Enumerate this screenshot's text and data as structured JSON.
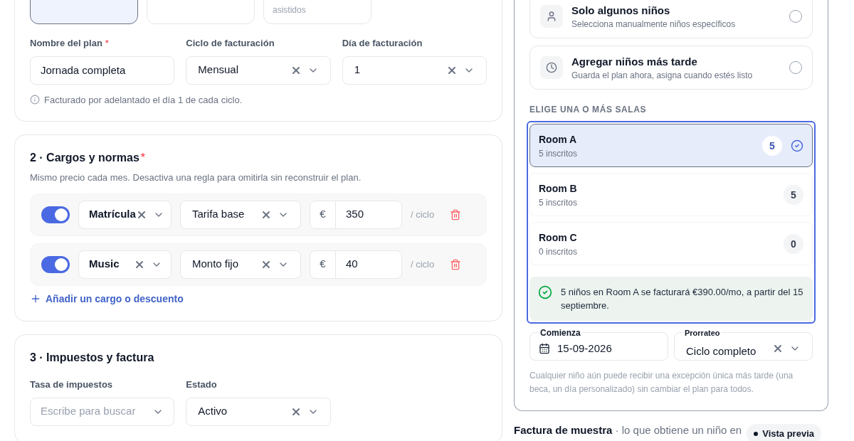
{
  "plan_types": [
    {
      "selected": true
    },
    {
      "selected": false
    },
    {
      "selected": false,
      "caption": "asistidos"
    }
  ],
  "plan_fields": [
    {
      "kind": "text",
      "label": "Nombre del plan",
      "required_mark": "*",
      "value": "Jornada completa"
    },
    {
      "kind": "select",
      "label": "Ciclo de facturación",
      "value": "Mensual"
    },
    {
      "kind": "select",
      "label": "Día de facturación",
      "value": "1"
    }
  ],
  "plan_hint": "Facturado por adelantado el día 1 de cada ciclo.",
  "charges": {
    "title": "2 · Cargos y normas",
    "required_mark": "*",
    "description": "Mismo precio cada mes. Desactiva una regla para omitirla sin reconstruir el plan.",
    "rules": [
      {
        "enabled": true,
        "name": "Matrícula",
        "type": "Tarifa base",
        "currency": "€",
        "amount": "350",
        "unit": "/ ciclo"
      },
      {
        "enabled": true,
        "name": "Music",
        "type": "Monto fijo",
        "currency": "€",
        "amount": "40",
        "unit": "/ ciclo"
      }
    ],
    "add_link": "Añadir un cargo o descuento"
  },
  "taxes": {
    "title": "3 · Impuestos y factura",
    "fields": [
      {
        "kind": "search",
        "label": "Tasa de impuestos",
        "placeholder": "Escribe para buscar"
      },
      {
        "kind": "select",
        "label": "Estado",
        "value": "Activo"
      }
    ]
  },
  "assign_options": [
    {
      "kind": "person",
      "title": "Solo algunos niños",
      "subtitle": "Selecciona manualmente niños específicos",
      "selected": false
    },
    {
      "kind": "clock",
      "title": "Agregar niños más tarde",
      "subtitle": "Guarda el plan ahora, asigna cuando estés listo",
      "selected": false
    }
  ],
  "rooms_label": "ELIGE UNA O MÁS SALAS",
  "rooms": [
    {
      "name": "Room A",
      "enrolled": "5 inscritos",
      "count": "5",
      "selected": true
    },
    {
      "name": "Room B",
      "enrolled": "5 inscritos",
      "count": "5",
      "selected": false
    },
    {
      "name": "Room C",
      "enrolled": "0 inscritos",
      "count": "0",
      "selected": false
    }
  ],
  "summary": "5 niños en Room A se facturará €390.00/mo, a partir del 15 septiembre.",
  "starts": {
    "label": "Comienza",
    "value": "15-09-2026"
  },
  "proration": {
    "label": "Prorrateo",
    "value": "Ciclo completo"
  },
  "note": "Cualquier niño aún puede recibir una excepción única más tarde (una beca, un día personalizado) sin cambiar el plan para todos.",
  "sample_invoice": {
    "title": "Factura de muestra",
    "subtitle": "· lo que obtiene un niño en",
    "badge": "Vista previa"
  }
}
